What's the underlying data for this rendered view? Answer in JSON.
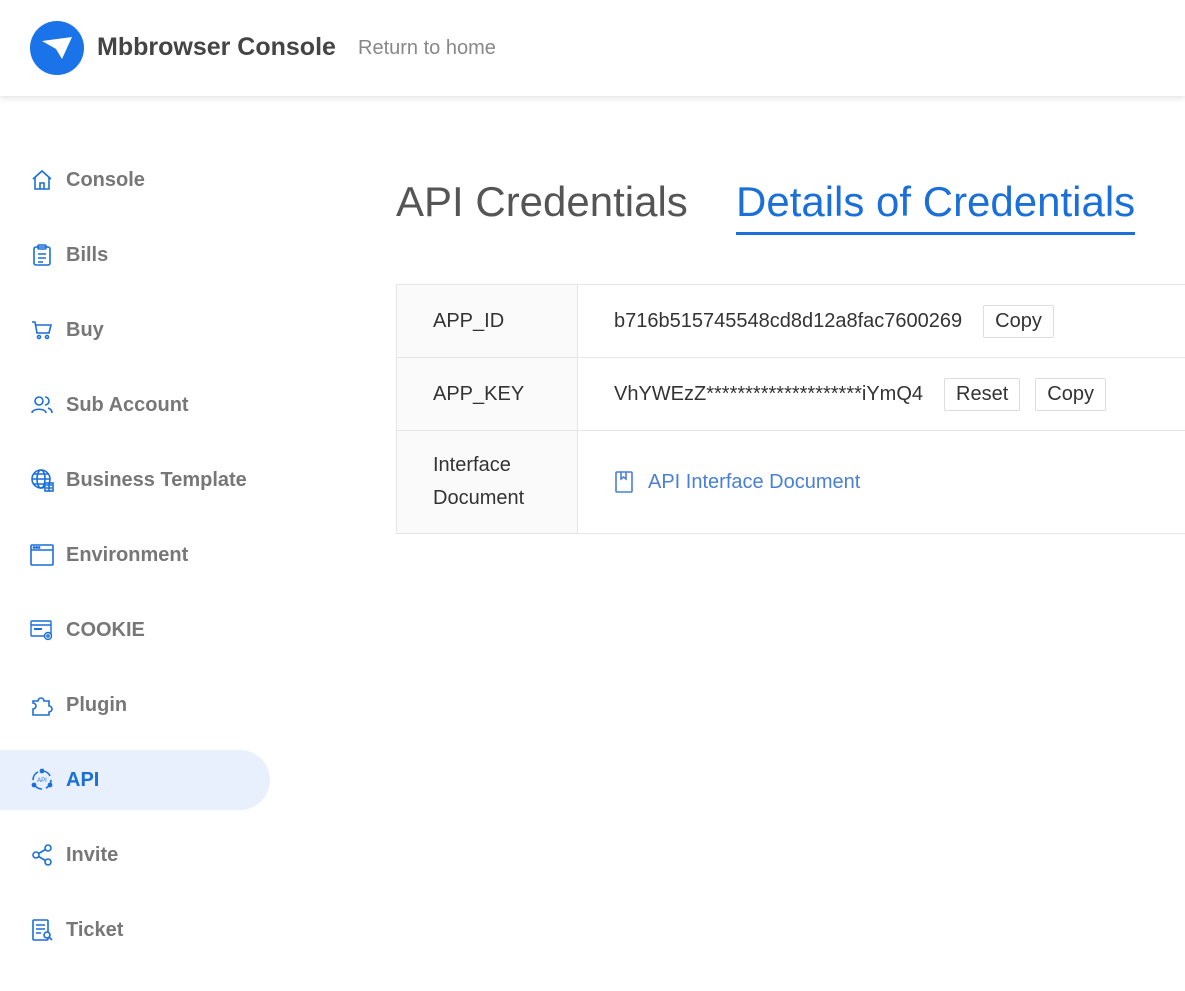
{
  "header": {
    "app_title": "Mbbrowser Console",
    "return_link": "Return to home"
  },
  "sidebar": {
    "items": [
      {
        "label": "Console",
        "icon": "home-icon",
        "active": false
      },
      {
        "label": "Bills",
        "icon": "clipboard-icon",
        "active": false
      },
      {
        "label": "Buy",
        "icon": "cart-icon",
        "active": false
      },
      {
        "label": "Sub Account",
        "icon": "users-icon",
        "active": false
      },
      {
        "label": "Business Template",
        "icon": "globe-icon",
        "active": false
      },
      {
        "label": "Environment",
        "icon": "browser-window-icon",
        "active": false
      },
      {
        "label": "COOKIE",
        "icon": "cookie-settings-icon",
        "active": false
      },
      {
        "label": "Plugin",
        "icon": "puzzle-icon",
        "active": false
      },
      {
        "label": "API",
        "icon": "api-icon",
        "active": true
      },
      {
        "label": "Invite",
        "icon": "share-icon",
        "active": false
      },
      {
        "label": "Ticket",
        "icon": "ticket-icon",
        "active": false
      }
    ]
  },
  "tabs": [
    {
      "label": "API Credentials",
      "active": false
    },
    {
      "label": "Details of Credentials",
      "active": true
    }
  ],
  "credentials": {
    "app_id_label": "APP_ID",
    "app_id_value": "b716b515745548cd8d12a8fac7600269",
    "app_key_label": "APP_KEY",
    "app_key_value": "VhYWEzZ********************iYmQ4",
    "doc_label": "Interface Document",
    "doc_link": "API Interface Document",
    "copy_label": "Copy",
    "reset_label": "Reset"
  },
  "colors": {
    "accent": "#1a6fd8",
    "active_bg": "#e8f0fe",
    "link": "#4a7fd6"
  }
}
